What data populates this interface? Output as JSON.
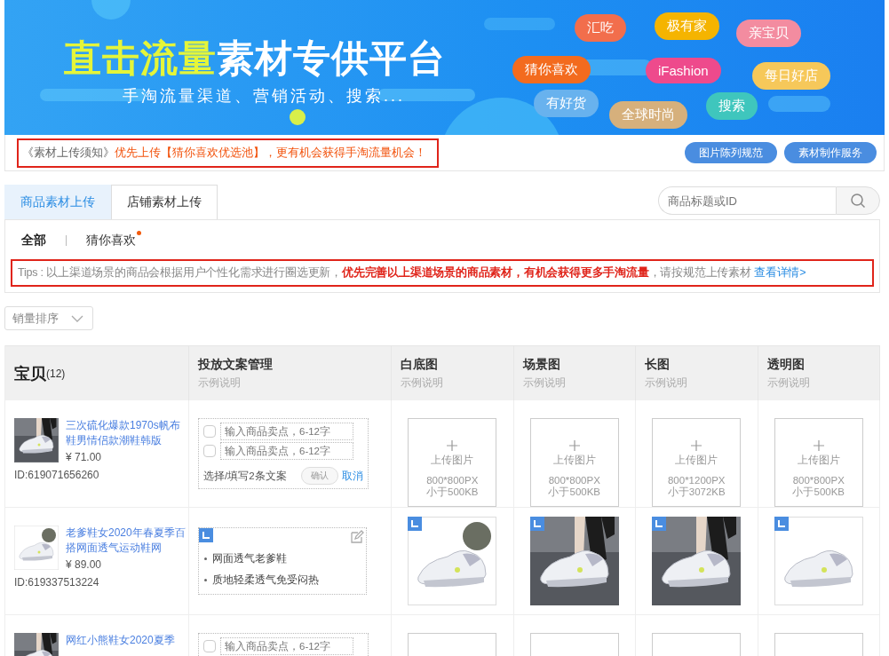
{
  "banner": {
    "title_highlight": "直击流量",
    "title_rest": "素材专供平台",
    "subtitle": "手淘流量渠道、营销活动、搜索...",
    "bubbles": [
      {
        "label": "汇吃",
        "color": "#f26e4c"
      },
      {
        "label": "极有家",
        "color": "#f5b400"
      },
      {
        "label": "亲宝贝",
        "color": "#f38ca0"
      },
      {
        "label": "猜你喜欢",
        "color": "#f36b1e"
      },
      {
        "label": "iFashion",
        "color": "#ee4a8c"
      },
      {
        "label": "每日好店",
        "color": "#f6c85a"
      },
      {
        "label": "有好货",
        "color": "#68b2ee"
      },
      {
        "label": "全球时尚",
        "color": "#d6b07c"
      },
      {
        "label": "搜索",
        "color": "#3fc6bd"
      }
    ]
  },
  "notice": {
    "link": "《素材上传须知》",
    "text": "优先上传【猜你喜欢优选池】，更有机会获得手淘流量机会！",
    "buttons": [
      "图片陈列规范",
      "素材制作服务"
    ]
  },
  "tabs": [
    {
      "label": "商品素材上传",
      "selected": true
    },
    {
      "label": "店铺素材上传",
      "selected": false
    }
  ],
  "search": {
    "placeholder": "商品标题或ID"
  },
  "filters": [
    {
      "label": "全部",
      "selected": true,
      "dot": false
    },
    {
      "label": "猜你喜欢",
      "selected": false,
      "dot": true
    }
  ],
  "tips": {
    "text": "Tips : 以上渠道场景的商品会根据用户个性化需求进行圈选更新，**优先完善以上渠道场景的商品素材，有机会获得更多手淘流量**，请按规范上传素材",
    "link": "查看详情>"
  },
  "sort": {
    "value": "销量排序"
  },
  "table": {
    "product_header": "宝贝",
    "product_count": "(12)",
    "columns": [
      {
        "title": "投放文案管理",
        "hint": "示例说明"
      },
      {
        "title": "白底图",
        "hint": "示例说明"
      },
      {
        "title": "场景图",
        "hint": "示例说明"
      },
      {
        "title": "长图",
        "hint": "示例说明"
      },
      {
        "title": "透明图",
        "hint": "示例说明"
      }
    ],
    "rows": [
      {
        "title": "三次硫化爆款1970s帆布鞋男情侣款潮鞋韩版",
        "price": "¥ 71.00",
        "id": "ID:619071656260",
        "copy": {
          "kind": "edit",
          "inputs": [
            {
              "placeholder": "输入商品卖点，6-12字",
              "checked": false
            },
            {
              "placeholder": "输入商品卖点，6-12字",
              "checked": false
            }
          ],
          "hint": "选择/填写2条文案",
          "confirm": "确认",
          "confirm_disabled": true,
          "cancel": "取消"
        },
        "images": [
          {
            "kind": "upload",
            "label": "上传图片",
            "size": "800*800PX",
            "limit": "小于500KB"
          },
          {
            "kind": "upload",
            "label": "上传图片",
            "size": "800*800PX",
            "limit": "小于500KB"
          },
          {
            "kind": "upload",
            "label": "上传图片",
            "size": "800*1200PX",
            "limit": "小于3072KB"
          },
          {
            "kind": "upload",
            "label": "上传图片",
            "size": "800*800PX",
            "limit": "小于500KB"
          }
        ]
      },
      {
        "title": "老爹鞋女2020年春夏季百搭网面透气运动鞋网",
        "price": "¥ 89.00",
        "id": "ID:619337513224",
        "copy": {
          "kind": "filled",
          "lines": [
            "网面透气老爹鞋",
            "质地轻柔透气免受闷热"
          ]
        }
      },
      {
        "title": "网红小熊鞋女2020夏季",
        "copy": {
          "kind": "edit",
          "inputs": [
            {
              "placeholder": "输入商品卖点，6-12字",
              "checked": false
            }
          ]
        },
        "images": [
          {
            "kind": "upload"
          },
          {
            "kind": "upload"
          },
          {
            "kind": "upload"
          },
          {
            "kind": "upload"
          }
        ]
      }
    ]
  }
}
